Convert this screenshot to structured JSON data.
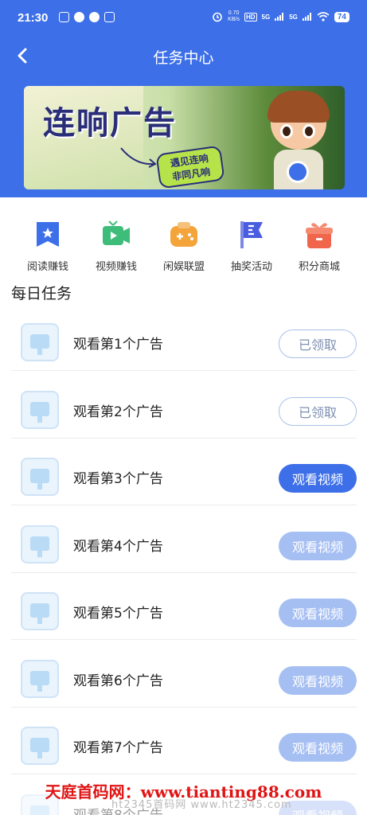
{
  "status_bar": {
    "time": "21:30",
    "net_speed_value": "0.70",
    "net_speed_unit": "KB/s",
    "hd_label": "HD",
    "signal_1": "5G",
    "signal_2": "5G",
    "battery": "74"
  },
  "nav": {
    "title": "任务中心"
  },
  "banner": {
    "title": "连响广告",
    "subtitle_line1": "遇见连响",
    "subtitle_line2": "非同凡响"
  },
  "shortcuts": [
    {
      "label": "阅读赚钱",
      "icon": "bookmark-icon",
      "color": "#3d6fe8"
    },
    {
      "label": "视频赚钱",
      "icon": "video-icon",
      "color": "#3ebd7a"
    },
    {
      "label": "闲娱联盟",
      "icon": "gamepad-icon",
      "color": "#f3a43a"
    },
    {
      "label": "抽奖活动",
      "icon": "flag-icon",
      "color": "#4a5de0"
    },
    {
      "label": "积分商城",
      "icon": "gift-icon",
      "color": "#f0654b"
    }
  ],
  "section": {
    "title": "每日任务"
  },
  "tasks": [
    {
      "label": "观看第1个广告",
      "button": "已领取",
      "state": "claimed"
    },
    {
      "label": "观看第2个广告",
      "button": "已领取",
      "state": "claimed"
    },
    {
      "label": "观看第3个广告",
      "button": "观看视频",
      "state": "active"
    },
    {
      "label": "观看第4个广告",
      "button": "观看视频",
      "state": "disabled"
    },
    {
      "label": "观看第5个广告",
      "button": "观看视频",
      "state": "disabled"
    },
    {
      "label": "观看第6个广告",
      "button": "观看视频",
      "state": "disabled"
    },
    {
      "label": "观看第7个广告",
      "button": "观看视频",
      "state": "disabled"
    },
    {
      "label": "观看第8个广告",
      "button": "观看视频",
      "state": "disabled"
    }
  ],
  "watermark": {
    "text": "天庭首码网：www.tianting88.com",
    "sub": "ht2345首码网 www.ht2345.com"
  },
  "colors": {
    "primary": "#3d6fe8",
    "disabled": "#a6bff3"
  }
}
